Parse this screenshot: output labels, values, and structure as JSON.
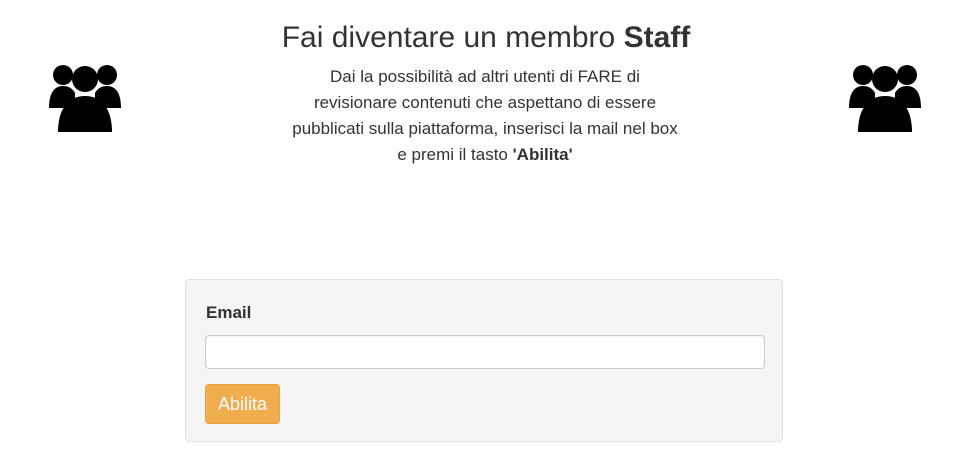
{
  "header": {
    "title_prefix": "Fai diventare un membro",
    "title_bold": "Staff",
    "description_prefix": "Dai la possibilità ad altri utenti di FARE di revisionare contenuti che aspettano di essere pubblicati sulla piattaforma, inserisci la mail nel box e premi il tasto",
    "description_bold": "'Abilita'"
  },
  "icons": {
    "left": "users-icon",
    "right": "users-icon"
  },
  "form": {
    "email_label": "Email",
    "email_value": "",
    "email_placeholder": "",
    "submit_label": "Abilita"
  },
  "colors": {
    "button_bg": "#f0ad4e",
    "button_border": "#eea236",
    "panel_bg": "#f5f5f5",
    "text": "#333333"
  }
}
